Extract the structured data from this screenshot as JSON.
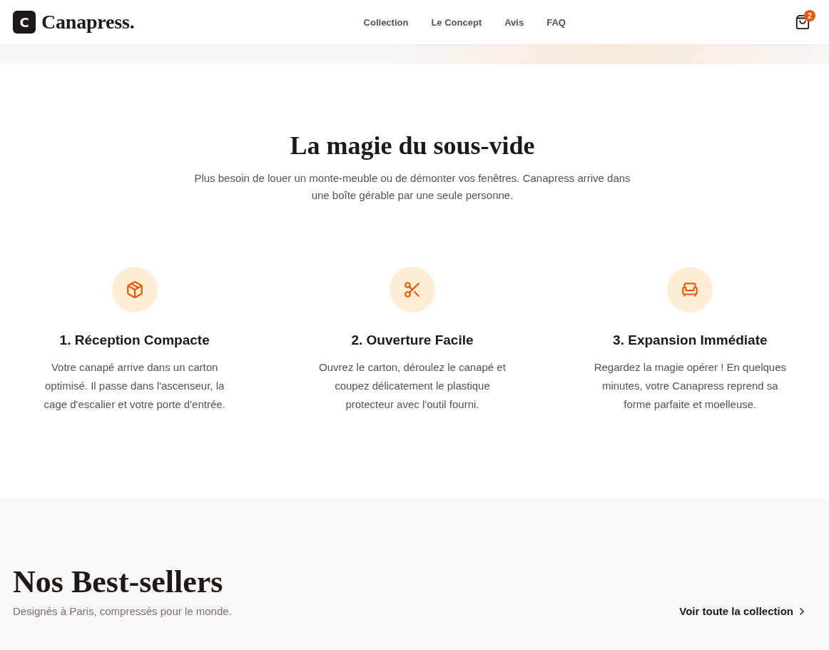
{
  "header": {
    "logo": {
      "mark": "C",
      "name": "Canapress."
    },
    "nav": [
      {
        "label": "Collection"
      },
      {
        "label": "Le Concept"
      },
      {
        "label": "Avis"
      },
      {
        "label": "FAQ"
      }
    ],
    "cart": {
      "count": "2"
    }
  },
  "concept": {
    "title": "La magie du sous-vide",
    "intro": "Plus besoin de louer un monte-meuble ou de démonter vos fenêtres. Canapress arrive dans une boîte gérable par une seule personne.",
    "steps": [
      {
        "title": "1. Réception Compacte",
        "text": "Votre canapé arrive dans un carton optimisé. Il passe dans l'ascenseur, la cage d'escalier et votre porte d'entrée."
      },
      {
        "title": "2. Ouverture Facile",
        "text": "Ouvrez le carton, déroulez le canapé et coupez délicatement le plastique protecteur avec l'outil fourni."
      },
      {
        "title": "3. Expansion Immédiate",
        "text": "Regardez la magie opérer ! En quelques minutes, votre Canapress reprend sa forme parfaite et moelleuse."
      }
    ]
  },
  "bestsellers": {
    "title": "Nos Best-sellers",
    "subtitle": "Designés à Paris, compressés pour le monde.",
    "link": "Voir toute la collection"
  }
}
